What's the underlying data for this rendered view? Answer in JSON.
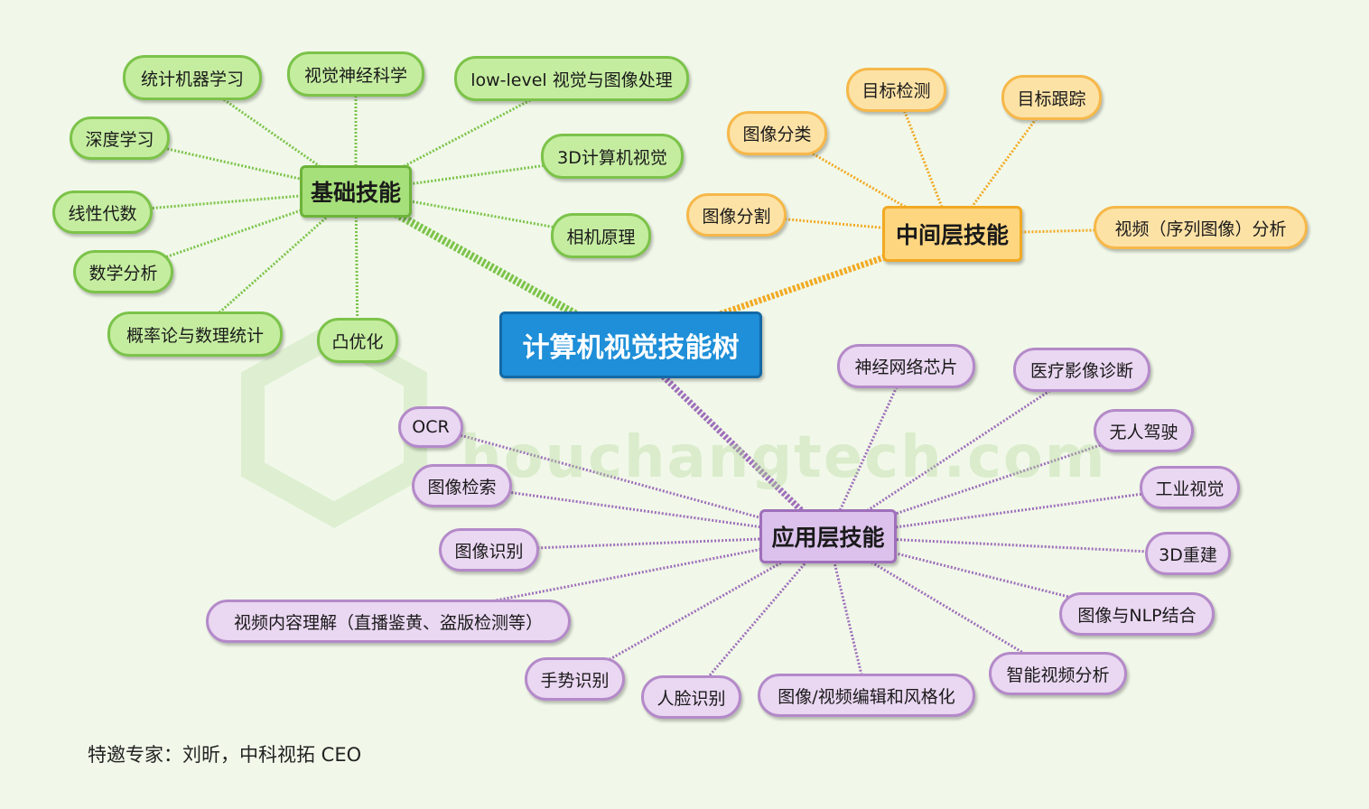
{
  "root": {
    "label": "计算机视觉技能树"
  },
  "branches": {
    "basic": {
      "label": "基础技能",
      "color": "green",
      "children": [
        "统计机器学习",
        "视觉神经科学",
        "low-level 视觉与图像处理",
        "深度学习",
        "3D计算机视觉",
        "线性代数",
        "相机原理",
        "数学分析",
        "概率论与数理统计",
        "凸优化"
      ]
    },
    "middle": {
      "label": "中间层技能",
      "color": "orange",
      "children": [
        "目标检测",
        "目标跟踪",
        "图像分类",
        "图像分割",
        "视频（序列图像）分析"
      ]
    },
    "application": {
      "label": "应用层技能",
      "color": "purple",
      "children": [
        "神经网络芯片",
        "医疗影像诊断",
        "无人驾驶",
        "工业视觉",
        "3D重建",
        "图像与NLP结合",
        "智能视频分析",
        "图像/视频编辑和风格化",
        "人脸识别",
        "手势识别",
        "视频内容理解（直播鉴黄、盗版检测等）",
        "图像识别",
        "图像检索",
        "OCR"
      ]
    }
  },
  "watermark": "houchangtech.com",
  "credit": "特邀专家：刘昕，中科视拓 CEO",
  "colors": {
    "background": "#f1f8e9",
    "green_line": "#7cc34a",
    "orange_line": "#f2a922",
    "purple_line": "#9f6fbb",
    "root": "#1e8fd8"
  }
}
